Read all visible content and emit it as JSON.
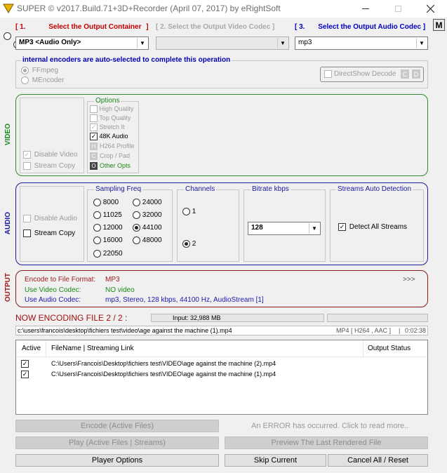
{
  "window": {
    "title": "SUPER ©   v2017.Build.71+3D+Recorder (April 07, 2017) by eRightSoft"
  },
  "steps": {
    "s1_num": "[ 1.",
    "s1_label": "Select the Output Container",
    "s1_close": "]",
    "s2_label": "[ 2.      Select the Output Video Codec ]",
    "s3_num": "[ 3.",
    "s3_label": "Select the Output Audio Codec ]",
    "m_label": "M"
  },
  "container_select": {
    "value": "MP3   <Audio Only>"
  },
  "video_codec_select": {
    "value": ""
  },
  "audio_codec_select": {
    "value": "mp3"
  },
  "encoders": {
    "title": "internal encoders are auto-selected to complete this operation",
    "ffmpeg": "FFmpeg",
    "mencoder": "MEncoder",
    "directshow": "DirectShow Decode",
    "c": "C",
    "d": "D"
  },
  "video": {
    "section_label": "VIDEO",
    "disable_video": "Disable Video",
    "stream_copy": "Stream Copy",
    "options_title": "Options",
    "options": {
      "high_quality": "High Quality",
      "top_quality": "Top Quality",
      "stretch_it": "Stretch It",
      "k48_audio": "48K Audio",
      "h264_profile": "H264 Profile",
      "crop_pad": "Crop / Pad",
      "other_opts": "Other Opts",
      "h": "H",
      "c": "C",
      "o": "O"
    }
  },
  "audio": {
    "section_label": "AUDIO",
    "disable_audio": "Disable Audio",
    "stream_copy": "Stream Copy",
    "sampling_title": "Sampling Freq",
    "freqs": [
      "8000",
      "24000",
      "11025",
      "32000",
      "12000",
      "44100",
      "16000",
      "48000",
      "22050"
    ],
    "selected_freq": "44100",
    "channels_title": "Channels",
    "ch1": "1",
    "ch2": "2",
    "selected_channel": "2",
    "bitrate_title": "Bitrate  kbps",
    "bitrate_value": "128",
    "streams_title": "Streams Auto Detection",
    "detect_all": "Detect All Streams"
  },
  "output": {
    "section_label": "OUTPUT",
    "format_label": "Encode to File Format:",
    "format_value": "MP3",
    "video_codec_label": "Use Video Codec:",
    "video_codec_value": "NO video",
    "audio_codec_label": "Use Audio Codec:",
    "audio_codec_value": "mp3,  Stereo,   128 kbps,   44100 Hz,  AudioStream [1]",
    "more": ">>>"
  },
  "status": {
    "now_encoding": "NOW ENCODING FILE 2 / 2 :",
    "input_size": "Input: 32,988 MB",
    "current_path": "c:\\users\\francois\\desktop\\fichiers test\\video\\age against the machine (1).mp4",
    "container_info": "MP4 [ H264 ,  AAC  ]",
    "duration": "0:02:38",
    "progress": 0
  },
  "file_list": {
    "col_active": "Active",
    "col_filename": "FileName   |   Streaming Link",
    "col_status": "Output Status",
    "rows": [
      {
        "active": true,
        "path": "C:\\Users\\Francois\\Desktop\\fichiers test\\VIDEO\\age against the machine (2).mp4",
        "status": ""
      },
      {
        "active": true,
        "path": "C:\\Users\\Francois\\Desktop\\fichiers test\\VIDEO\\age against the machine (1).mp4",
        "status": ""
      }
    ]
  },
  "buttons": {
    "encode": "Encode (Active Files)",
    "error_msg": "An ERROR has occurred. Click to read more..",
    "play": "Play (Active Files | Streams)",
    "preview": "Preview The Last Rendered File",
    "player_options": "Player Options",
    "skip_current": "Skip Current",
    "cancel_reset": "Cancel All   /   Reset"
  }
}
